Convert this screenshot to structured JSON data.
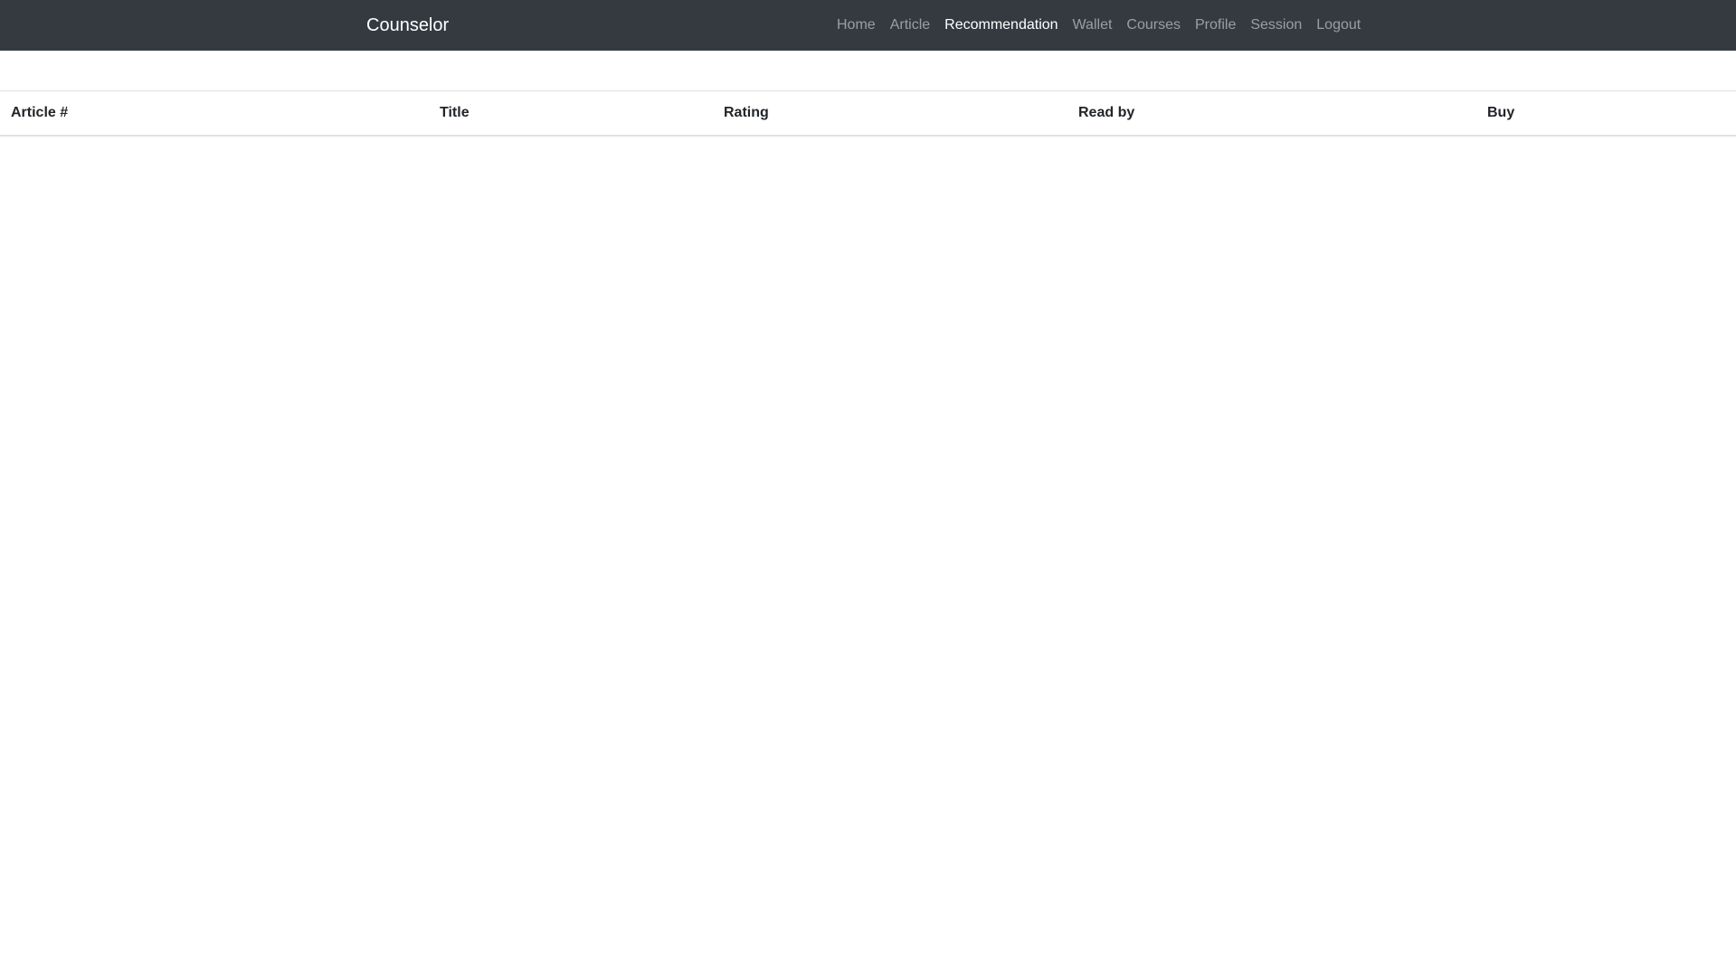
{
  "navbar": {
    "brand": "Counselor",
    "items": [
      {
        "label": "Home",
        "active": false
      },
      {
        "label": "Article",
        "active": false
      },
      {
        "label": "Recommendation",
        "active": true
      },
      {
        "label": "Wallet",
        "active": false
      },
      {
        "label": "Courses",
        "active": false
      },
      {
        "label": "Profile",
        "active": false
      },
      {
        "label": "Session",
        "active": false
      },
      {
        "label": "Logout",
        "active": false
      }
    ],
    "colors": {
      "background": "#343a40",
      "active_link": "#ffffff",
      "inactive_link": "rgba(255,255,255,0.5)"
    }
  },
  "table": {
    "columns": [
      "Article #",
      "Title",
      "Rating",
      "Read by",
      "Buy"
    ],
    "rows": []
  }
}
